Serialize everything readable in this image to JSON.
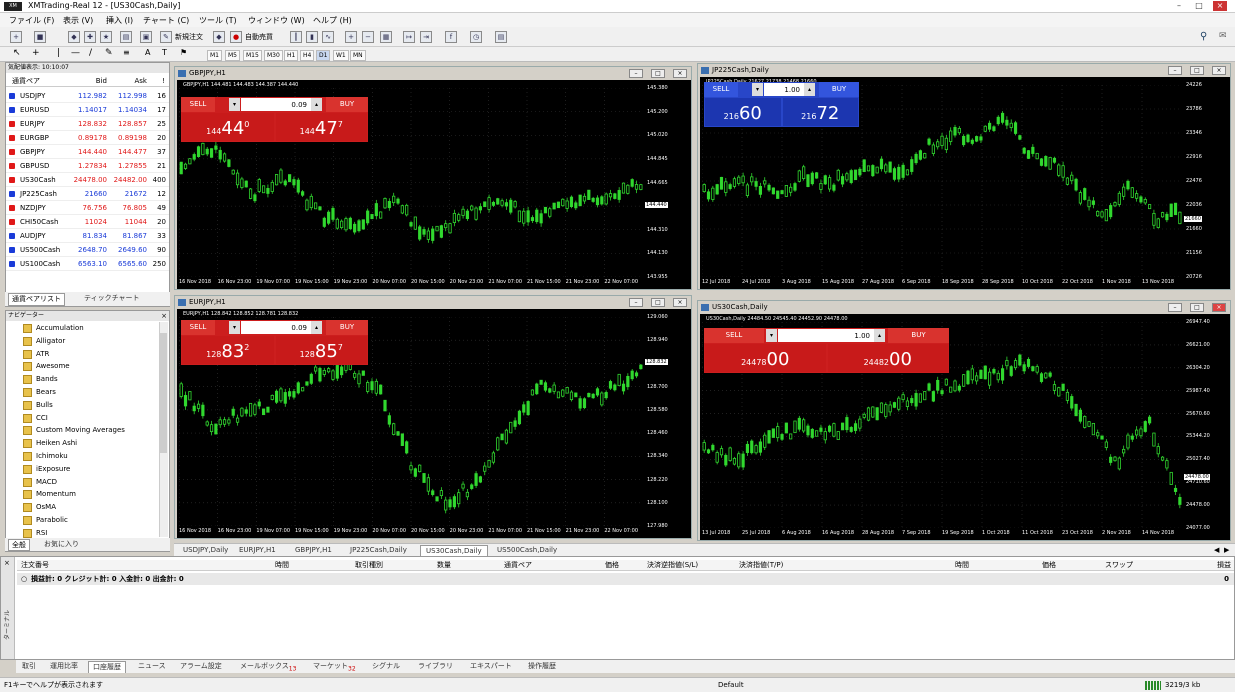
{
  "window": {
    "title": "XMTrading-Real 12 - [US30Cash,Daily]"
  },
  "menu": [
    "ファイル (F)",
    "表示 (V)",
    "挿入 (I)",
    "チャート (C)",
    "ツール (T)",
    "ウィンドウ (W)",
    "ヘルプ (H)"
  ],
  "toolbar": {
    "new_order": "新規注文",
    "auto_trading": "自動売買"
  },
  "timeframes": [
    "M1",
    "M5",
    "M15",
    "M30",
    "H1",
    "H4",
    "D1",
    "W1",
    "MN"
  ],
  "market_watch": {
    "header": "気配値表示: 10:10:07",
    "col_symbol": "通貨ペア",
    "col_bid": "Bid",
    "col_ask": "Ask",
    "col_spread": "!",
    "rows": [
      {
        "symbol": "USDJPY",
        "bid": "112.982",
        "ask": "112.998",
        "spread": "16",
        "color": "blue"
      },
      {
        "symbol": "EURUSD",
        "bid": "1.14017",
        "ask": "1.14034",
        "spread": "17",
        "color": "blue"
      },
      {
        "symbol": "EURJPY",
        "bid": "128.832",
        "ask": "128.857",
        "spread": "25",
        "color": "red"
      },
      {
        "symbol": "EURGBP",
        "bid": "0.89178",
        "ask": "0.89198",
        "spread": "20",
        "color": "red"
      },
      {
        "symbol": "GBPJPY",
        "bid": "144.440",
        "ask": "144.477",
        "spread": "37",
        "color": "red"
      },
      {
        "symbol": "GBPUSD",
        "bid": "1.27834",
        "ask": "1.27855",
        "spread": "21",
        "color": "red"
      },
      {
        "symbol": "US30Cash",
        "bid": "24478.00",
        "ask": "24482.00",
        "spread": "400",
        "color": "red"
      },
      {
        "symbol": "JP225Cash",
        "bid": "21660",
        "ask": "21672",
        "spread": "12",
        "color": "blue"
      },
      {
        "symbol": "NZDJPY",
        "bid": "76.756",
        "ask": "76.805",
        "spread": "49",
        "color": "red"
      },
      {
        "symbol": "CHI50Cash",
        "bid": "11024",
        "ask": "11044",
        "spread": "20",
        "color": "red"
      },
      {
        "symbol": "AUDJPY",
        "bid": "81.834",
        "ask": "81.867",
        "spread": "33",
        "color": "blue"
      },
      {
        "symbol": "US500Cash",
        "bid": "2648.70",
        "ask": "2649.60",
        "spread": "90",
        "color": "blue"
      },
      {
        "symbol": "US100Cash",
        "bid": "6563.10",
        "ask": "6565.60",
        "spread": "250",
        "color": "blue"
      }
    ],
    "tabs": [
      "通貨ペアリスト",
      "ティックチャート"
    ]
  },
  "navigator": {
    "header": "ナビゲーター",
    "items": [
      "Accumulation",
      "Alligator",
      "ATR",
      "Awesome",
      "Bands",
      "Bears",
      "Bulls",
      "CCI",
      "Custom Moving Averages",
      "Heiken Ashi",
      "Ichimoku",
      "iExposure",
      "MACD",
      "Momentum",
      "OsMA",
      "Parabolic",
      "RSI"
    ],
    "tabs": [
      "全般",
      "お気に入り"
    ]
  },
  "charts": [
    {
      "title": "GBPJPY,H1",
      "header": "GBPJPY,H1 144.481 144.483 144.387 144.440",
      "sell": "SELL",
      "buy": "BUY",
      "volume": "0.09",
      "sell_small": "144",
      "sell_big": "44",
      "sell_sup": "0",
      "buy_small": "144",
      "buy_big": "47",
      "buy_sup": "7",
      "price_labels": [
        "145.380",
        "145.200",
        "145.020",
        "144.845",
        "144.665",
        "144.485",
        "144.310",
        "144.130",
        "143.955"
      ],
      "current": "144.440",
      "dates": [
        "16 Nov 2018",
        "16 Nov 23:00",
        "19 Nov 07:00",
        "19 Nov 15:00",
        "19 Nov 23:00",
        "20 Nov 07:00",
        "20 Nov 15:00",
        "20 Nov 23:00",
        "21 Nov 07:00",
        "21 Nov 15:00",
        "21 Nov 23:00",
        "22 Nov 07:00"
      ]
    },
    {
      "title": "JP225Cash,Daily",
      "header": "JP225Cash,Daily 21627 21738 21468 21660",
      "sell": "SELL",
      "buy": "BUY",
      "volume": "1.00",
      "sell_small": "216",
      "sell_big": "60",
      "sell_sup": "",
      "buy_small": "216",
      "buy_big": "72",
      "buy_sup": "",
      "price_labels": [
        "24226",
        "23786",
        "23346",
        "22916",
        "22476",
        "22036",
        "21660",
        "21156",
        "20726"
      ],
      "current": "21660",
      "dates": [
        "12 Jul 2018",
        "24 Jul 2018",
        "3 Aug 2018",
        "15 Aug 2018",
        "27 Aug 2018",
        "6 Sep 2018",
        "18 Sep 2018",
        "28 Sep 2018",
        "10 Oct 2018",
        "22 Oct 2018",
        "1 Nov 2018",
        "13 Nov 2018"
      ]
    },
    {
      "title": "EURJPY,H1",
      "header": "EURJPY,H1 128.842 128.852 128.781 128.832",
      "sell": "SELL",
      "buy": "BUY",
      "volume": "0.09",
      "sell_small": "128",
      "sell_big": "83",
      "sell_sup": "2",
      "buy_small": "128",
      "buy_big": "85",
      "buy_sup": "7",
      "price_labels": [
        "129.060",
        "128.940",
        "128.832",
        "128.700",
        "128.580",
        "128.460",
        "128.340",
        "128.220",
        "128.100",
        "127.980"
      ],
      "current": "128.832",
      "dates": [
        "16 Nov 2018",
        "16 Nov 23:00",
        "19 Nov 07:00",
        "19 Nov 15:00",
        "19 Nov 23:00",
        "20 Nov 07:00",
        "20 Nov 15:00",
        "20 Nov 23:00",
        "21 Nov 07:00",
        "21 Nov 15:00",
        "21 Nov 23:00",
        "22 Nov 07:00"
      ]
    },
    {
      "title": "US30Cash,Daily",
      "header": "US30Cash,Daily 24484.50 24545.40 24452.90 24478.00",
      "sell": "SELL",
      "buy": "BUY",
      "volume": "1.00",
      "sell_small": "24478",
      "sell_big": "00",
      "sell_sup": "",
      "buy_small": "24482",
      "buy_big": "00",
      "buy_sup": "",
      "price_labels": [
        "26947.40",
        "26621.00",
        "26304.20",
        "25987.40",
        "25670.60",
        "25344.20",
        "25027.40",
        "24710.60",
        "24478.00",
        "24077.00"
      ],
      "current": "24478.00",
      "dates": [
        "13 Jul 2018",
        "25 Jul 2018",
        "6 Aug 2018",
        "16 Aug 2018",
        "28 Aug 2018",
        "7 Sep 2018",
        "19 Sep 2018",
        "1 Oct 2018",
        "11 Oct 2018",
        "23 Oct 2018",
        "2 Nov 2018",
        "14 Nov 2018"
      ]
    }
  ],
  "chart_tabs": [
    "USDJPY,Daily",
    "EURJPY,H1",
    "GBPJPY,H1",
    "JP225Cash,Daily",
    "US30Cash,Daily",
    "US500Cash,Daily"
  ],
  "terminal": {
    "columns": [
      "注文番号",
      "時間",
      "取引種別",
      "数量",
      "通貨ペア",
      "価格",
      "決済逆指値(S/L)",
      "決済指値(T/P)",
      "時間",
      "価格",
      "スワップ",
      "損益"
    ],
    "balance": "損益計: 0  クレジット計: 0  入金計: 0  出金計: 0",
    "balance_value": "0",
    "tabs": [
      "取引",
      "運用比率",
      "口座履歴",
      "ニュース",
      "アラーム設定",
      "メールボックス",
      "マーケット",
      "シグナル",
      "ライブラリ",
      "エキスパート",
      "操作履歴"
    ],
    "mail_count": "13",
    "market_count": "32",
    "side_label": "ターミナル"
  },
  "status": {
    "help": "F1キーでヘルプが表示されます",
    "profile": "Default",
    "traffic": "3219/3 kb"
  }
}
